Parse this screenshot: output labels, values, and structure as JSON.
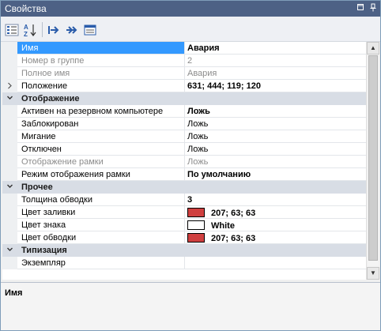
{
  "titlebar": {
    "title": "Свойства",
    "buttons": [
      "restore-icon",
      "pin-icon"
    ]
  },
  "toolbar": {
    "items": [
      "categorized-icon",
      "alphabetical-sort-icon",
      "properties-icon",
      "events-icon",
      "property-pages-icon"
    ]
  },
  "grid": {
    "rows": [
      {
        "type": "prop",
        "name": "Имя",
        "value": "Авария",
        "selected": true,
        "value_bold": true
      },
      {
        "type": "prop",
        "name": "Номер в группе",
        "value": "2",
        "disabled": true
      },
      {
        "type": "prop",
        "name": "Полное имя",
        "value": "Авария",
        "disabled": true
      },
      {
        "type": "prop",
        "name": "Положение",
        "value": "631; 444; 119; 120",
        "value_bold": true,
        "expandable": true
      },
      {
        "type": "cat",
        "name": "Отображение"
      },
      {
        "type": "prop",
        "name": "Активен на резервном компьютере",
        "value": "Ложь",
        "value_bold": true
      },
      {
        "type": "prop",
        "name": "Заблокирован",
        "value": "Ложь"
      },
      {
        "type": "prop",
        "name": "Мигание",
        "value": "Ложь"
      },
      {
        "type": "prop",
        "name": "Отключен",
        "value": "Ложь"
      },
      {
        "type": "prop",
        "name": "Отображение рамки",
        "value": "Ложь",
        "disabled": true
      },
      {
        "type": "prop",
        "name": "Режим отображения рамки",
        "value": "По умолчанию",
        "value_bold": true
      },
      {
        "type": "cat",
        "name": "Прочее"
      },
      {
        "type": "prop",
        "name": "Толщина обводки",
        "value": "3",
        "value_bold": true
      },
      {
        "type": "prop",
        "name": "Цвет заливки",
        "value": "207; 63; 63",
        "value_bold": true,
        "swatch": "#cf3f3f"
      },
      {
        "type": "prop",
        "name": "Цвет знака",
        "value": "White",
        "value_bold": true,
        "swatch": "#ffffff"
      },
      {
        "type": "prop",
        "name": "Цвет обводки",
        "value": "207; 63; 63",
        "value_bold": true,
        "swatch": "#cf3f3f"
      },
      {
        "type": "cat",
        "name": "Типизация"
      },
      {
        "type": "prop",
        "name": "Экземпляр",
        "value": ""
      }
    ]
  },
  "description": {
    "title": "Имя"
  },
  "colors": {
    "titlebar": "#4d6185",
    "selection": "#3399ff",
    "category": "#d8dde5"
  }
}
